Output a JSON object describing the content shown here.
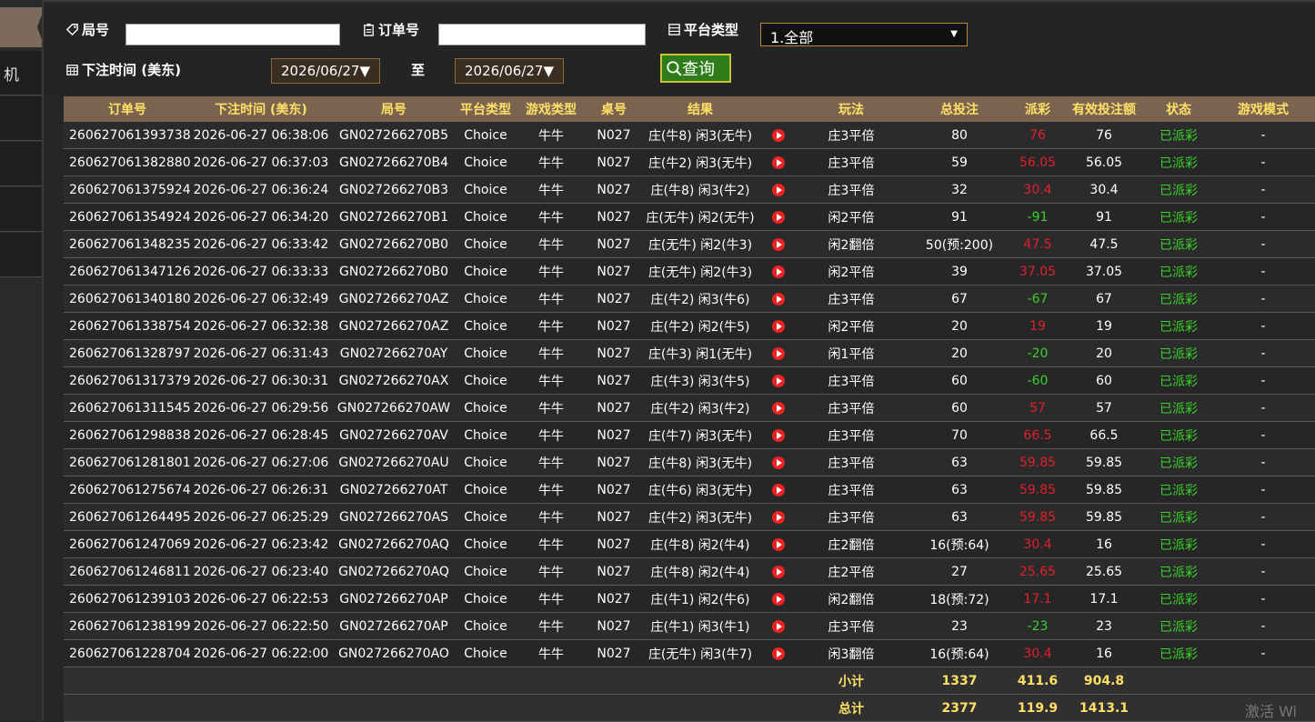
{
  "sidebar": {
    "item_label": "机"
  },
  "filters": {
    "round_label": "局号",
    "order_label": "订单号",
    "platform_label": "平台类型",
    "platform_value": "1.全部",
    "bet_time_label": "下注时间 (美东)",
    "date_from": "2026/06/27▼",
    "to_label": "至",
    "date_to": "2026/06/27▼",
    "query_label": "查询"
  },
  "table": {
    "headers": [
      "订单号",
      "下注时间 (美东)",
      "局号",
      "平台类型",
      "游戏类型",
      "桌号",
      "结果",
      "",
      "玩法",
      "总投注",
      "派彩",
      "有效投注额",
      "状态",
      "游戏模式"
    ],
    "rows": [
      [
        "260627061393738",
        "2026-06-27 06:38:06",
        "GN027266270B5",
        "Choice",
        "牛牛",
        "N027",
        "庄(牛8) 闲3(无牛)",
        "庄3平倍",
        "80",
        "76",
        "76",
        "已派彩",
        "-"
      ],
      [
        "260627061382880",
        "2026-06-27 06:37:03",
        "GN027266270B4",
        "Choice",
        "牛牛",
        "N027",
        "庄(牛2) 闲3(无牛)",
        "庄3平倍",
        "59",
        "56.05",
        "56.05",
        "已派彩",
        "-"
      ],
      [
        "260627061375924",
        "2026-06-27 06:36:24",
        "GN027266270B3",
        "Choice",
        "牛牛",
        "N027",
        "庄(牛8) 闲3(牛2)",
        "庄3平倍",
        "32",
        "30.4",
        "30.4",
        "已派彩",
        "-"
      ],
      [
        "260627061354924",
        "2026-06-27 06:34:20",
        "GN027266270B1",
        "Choice",
        "牛牛",
        "N027",
        "庄(无牛) 闲2(无牛)",
        "闲2平倍",
        "91",
        "-91",
        "91",
        "已派彩",
        "-"
      ],
      [
        "260627061348235",
        "2026-06-27 06:33:42",
        "GN027266270B0",
        "Choice",
        "牛牛",
        "N027",
        "庄(无牛) 闲2(牛3)",
        "闲2翻倍",
        "50(预:200)",
        "47.5",
        "47.5",
        "已派彩",
        "-"
      ],
      [
        "260627061347126",
        "2026-06-27 06:33:33",
        "GN027266270B0",
        "Choice",
        "牛牛",
        "N027",
        "庄(无牛) 闲2(牛3)",
        "闲2平倍",
        "39",
        "37.05",
        "37.05",
        "已派彩",
        "-"
      ],
      [
        "260627061340180",
        "2026-06-27 06:32:49",
        "GN027266270AZ",
        "Choice",
        "牛牛",
        "N027",
        "庄(牛2) 闲3(牛6)",
        "庄3平倍",
        "67",
        "-67",
        "67",
        "已派彩",
        "-"
      ],
      [
        "260627061338754",
        "2026-06-27 06:32:38",
        "GN027266270AZ",
        "Choice",
        "牛牛",
        "N027",
        "庄(牛2) 闲2(牛5)",
        "闲2平倍",
        "20",
        "19",
        "19",
        "已派彩",
        "-"
      ],
      [
        "260627061328797",
        "2026-06-27 06:31:43",
        "GN027266270AY",
        "Choice",
        "牛牛",
        "N027",
        "庄(牛3) 闲1(无牛)",
        "闲1平倍",
        "20",
        "-20",
        "20",
        "已派彩",
        "-"
      ],
      [
        "260627061317379",
        "2026-06-27 06:30:31",
        "GN027266270AX",
        "Choice",
        "牛牛",
        "N027",
        "庄(牛3) 闲3(牛5)",
        "庄3平倍",
        "60",
        "-60",
        "60",
        "已派彩",
        "-"
      ],
      [
        "260627061311545",
        "2026-06-27 06:29:56",
        "GN027266270AW",
        "Choice",
        "牛牛",
        "N027",
        "庄(牛2) 闲3(牛2)",
        "庄3平倍",
        "60",
        "57",
        "57",
        "已派彩",
        "-"
      ],
      [
        "260627061298838",
        "2026-06-27 06:28:45",
        "GN027266270AV",
        "Choice",
        "牛牛",
        "N027",
        "庄(牛7) 闲3(无牛)",
        "庄3平倍",
        "70",
        "66.5",
        "66.5",
        "已派彩",
        "-"
      ],
      [
        "260627061281801",
        "2026-06-27 06:27:06",
        "GN027266270AU",
        "Choice",
        "牛牛",
        "N027",
        "庄(牛8) 闲3(无牛)",
        "庄3平倍",
        "63",
        "59.85",
        "59.85",
        "已派彩",
        "-"
      ],
      [
        "260627061275674",
        "2026-06-27 06:26:31",
        "GN027266270AT",
        "Choice",
        "牛牛",
        "N027",
        "庄(牛6) 闲3(无牛)",
        "庄3平倍",
        "63",
        "59.85",
        "59.85",
        "已派彩",
        "-"
      ],
      [
        "260627061264495",
        "2026-06-27 06:25:29",
        "GN027266270AS",
        "Choice",
        "牛牛",
        "N027",
        "庄(牛2) 闲3(无牛)",
        "庄3平倍",
        "63",
        "59.85",
        "59.85",
        "已派彩",
        "-"
      ],
      [
        "260627061247069",
        "2026-06-27 06:23:42",
        "GN027266270AQ",
        "Choice",
        "牛牛",
        "N027",
        "庄(牛8) 闲2(牛4)",
        "庄2翻倍",
        "16(预:64)",
        "30.4",
        "16",
        "已派彩",
        "-"
      ],
      [
        "260627061246811",
        "2026-06-27 06:23:40",
        "GN027266270AQ",
        "Choice",
        "牛牛",
        "N027",
        "庄(牛8) 闲2(牛4)",
        "庄2平倍",
        "27",
        "25.65",
        "25.65",
        "已派彩",
        "-"
      ],
      [
        "260627061239103",
        "2026-06-27 06:22:53",
        "GN027266270AP",
        "Choice",
        "牛牛",
        "N027",
        "庄(牛1) 闲2(牛6)",
        "闲2翻倍",
        "18(预:72)",
        "17.1",
        "17.1",
        "已派彩",
        "-"
      ],
      [
        "260627061238199",
        "2026-06-27 06:22:50",
        "GN027266270AP",
        "Choice",
        "牛牛",
        "N027",
        "庄(牛1) 闲3(牛1)",
        "庄3平倍",
        "23",
        "-23",
        "23",
        "已派彩",
        "-"
      ],
      [
        "260627061228704",
        "2026-06-27 06:22:00",
        "GN027266270AO",
        "Choice",
        "牛牛",
        "N027",
        "庄(无牛) 闲3(牛7)",
        "闲3翻倍",
        "16(预:64)",
        "30.4",
        "16",
        "已派彩",
        "-"
      ]
    ],
    "subtotal": {
      "label": "小计",
      "total_bet": "1337",
      "payout": "411.6",
      "valid_bet": "904.8"
    },
    "total": {
      "label": "总计",
      "total_bet": "2377",
      "payout": "119.9",
      "valid_bet": "1413.1"
    }
  },
  "colors": {
    "positive_payout": "#e0202c",
    "negative_payout": "#39d22a",
    "status": "#39d22a",
    "header_bg": "#7a6450",
    "header_text": "#ffe066"
  },
  "watermark": "激活 Wi"
}
